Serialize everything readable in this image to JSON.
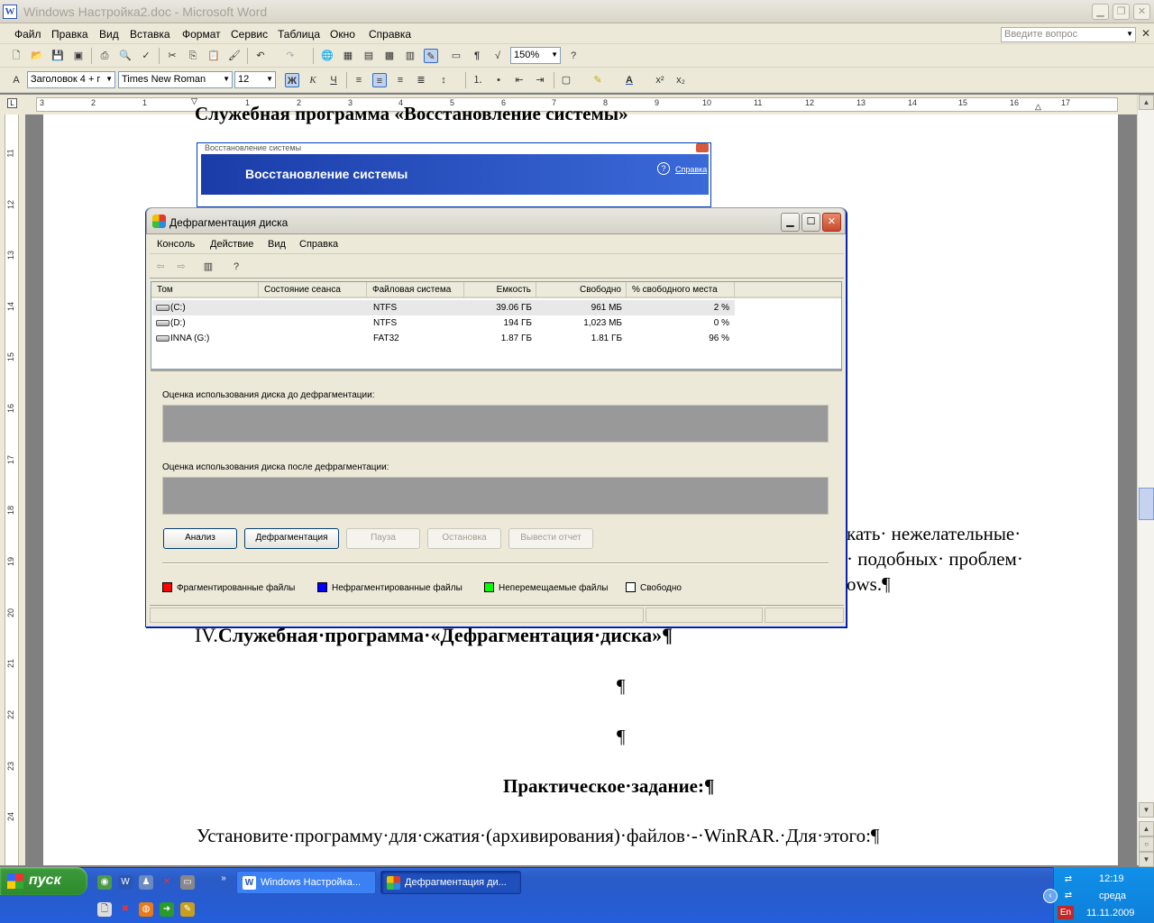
{
  "word": {
    "title": "Windows Настройка2.doc - Microsoft Word",
    "menu": [
      "Файл",
      "Правка",
      "Вид",
      "Вставка",
      "Формат",
      "Сервис",
      "Таблица",
      "Окно",
      "Справка"
    ],
    "ask_placeholder": "Введите вопрос",
    "zoom": "150%",
    "style": "Заголовок 4 + г",
    "font": "Times New Roman",
    "size": "12",
    "bold": "Ж",
    "italic": "К",
    "underline": "Ч",
    "ruler_h": [
      "3",
      "2",
      "1",
      "1",
      "2",
      "3",
      "4",
      "5",
      "6",
      "7",
      "8",
      "9",
      "10",
      "11",
      "12",
      "13",
      "14",
      "15",
      "16",
      "17"
    ],
    "ruler_v": [
      "11",
      "12",
      "13",
      "14",
      "15",
      "16",
      "17",
      "18",
      "19",
      "20",
      "21",
      "22",
      "23",
      "24"
    ],
    "doc": {
      "heading3_partial": "Служебная программа «Восстановление системы»",
      "para_frag1": "кать· нежелательные·",
      "para_frag2": "· подобных· проблем·",
      "para_frag3": "ows.¶",
      "heading4_num": "IV.",
      "heading4": "Служебная·программа·«Дефрагментация·диска»¶",
      "pilcrow1": "¶",
      "pilcrow2": "¶",
      "practical": "Практическое·задание:¶",
      "task": "Установите·программу·для·сжатия·(архивирования)·файлов·-·WinRAR.·Для·этого:¶"
    }
  },
  "sysrestore": {
    "caption": "Восстановление системы",
    "title": "Восстановление системы",
    "help": "Справка"
  },
  "defrag": {
    "title": "Дефрагментация диска",
    "menu": [
      "Консоль",
      "Действие",
      "Вид",
      "Справка"
    ],
    "columns": [
      "Том",
      "Состояние сеанса",
      "Файловая система",
      "Емкость",
      "Свободно",
      "% свободного места"
    ],
    "rows": [
      {
        "vol": "(C:)",
        "state": "",
        "fs": "NTFS",
        "cap": "39.06 ГБ",
        "free": "961 МБ",
        "pct": "2 %"
      },
      {
        "vol": "(D:)",
        "state": "",
        "fs": "NTFS",
        "cap": "194 ГБ",
        "free": "1,023 МБ",
        "pct": "0 %"
      },
      {
        "vol": "INNA (G:)",
        "state": "",
        "fs": "FAT32",
        "cap": "1.87 ГБ",
        "free": "1.81 ГБ",
        "pct": "96 %"
      }
    ],
    "before_label": "Оценка использования диска до дефрагментации:",
    "after_label": "Оценка использования диска после дефрагментации:",
    "buttons": {
      "analyze": "Анализ",
      "defrag": "Дефрагментация",
      "pause": "Пауза",
      "stop": "Остановка",
      "report": "Вывести отчет"
    },
    "legend": {
      "fragmented": "Фрагментированные файлы",
      "contiguous": "Нефрагментированные файлы",
      "unmovable": "Неперемещаемые файлы",
      "free": "Свободно"
    },
    "colors": {
      "fragmented": "#ff0000",
      "contiguous": "#0000ff",
      "unmovable": "#00ff00",
      "free": "#ffffff"
    }
  },
  "taskbar": {
    "start": "пуск",
    "tasks": [
      "Windows Настройка...",
      "Дефрагментация ди..."
    ],
    "time": "12:19",
    "day": "среда",
    "date": "11.11.2009",
    "lang": "En"
  }
}
